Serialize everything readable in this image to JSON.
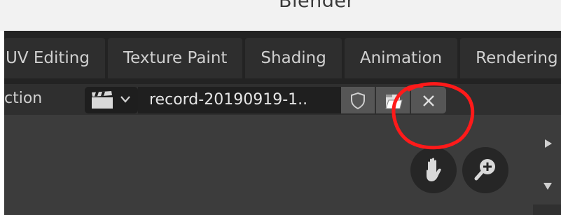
{
  "window": {
    "title": "Blender"
  },
  "tabs": [
    {
      "label": "UV Editing"
    },
    {
      "label": "Texture Paint"
    },
    {
      "label": "Shading"
    },
    {
      "label": "Animation"
    },
    {
      "label": "Rendering"
    }
  ],
  "header": {
    "label": "ction",
    "clip_name": "record-20190919-1..",
    "icons": [
      "movie-clip-icon",
      "chevron-down-icon",
      "shield-icon",
      "folder-icon",
      "close-icon"
    ]
  },
  "viewport": {
    "nav_icons": [
      "hand-pan-icon",
      "zoom-icon"
    ],
    "arrows": [
      "arrow-right-icon",
      "arrow-down-icon"
    ]
  },
  "colors": {
    "annotation": "#ff1a1a",
    "topbar": "#232323",
    "panel": "#3d3d3d"
  }
}
